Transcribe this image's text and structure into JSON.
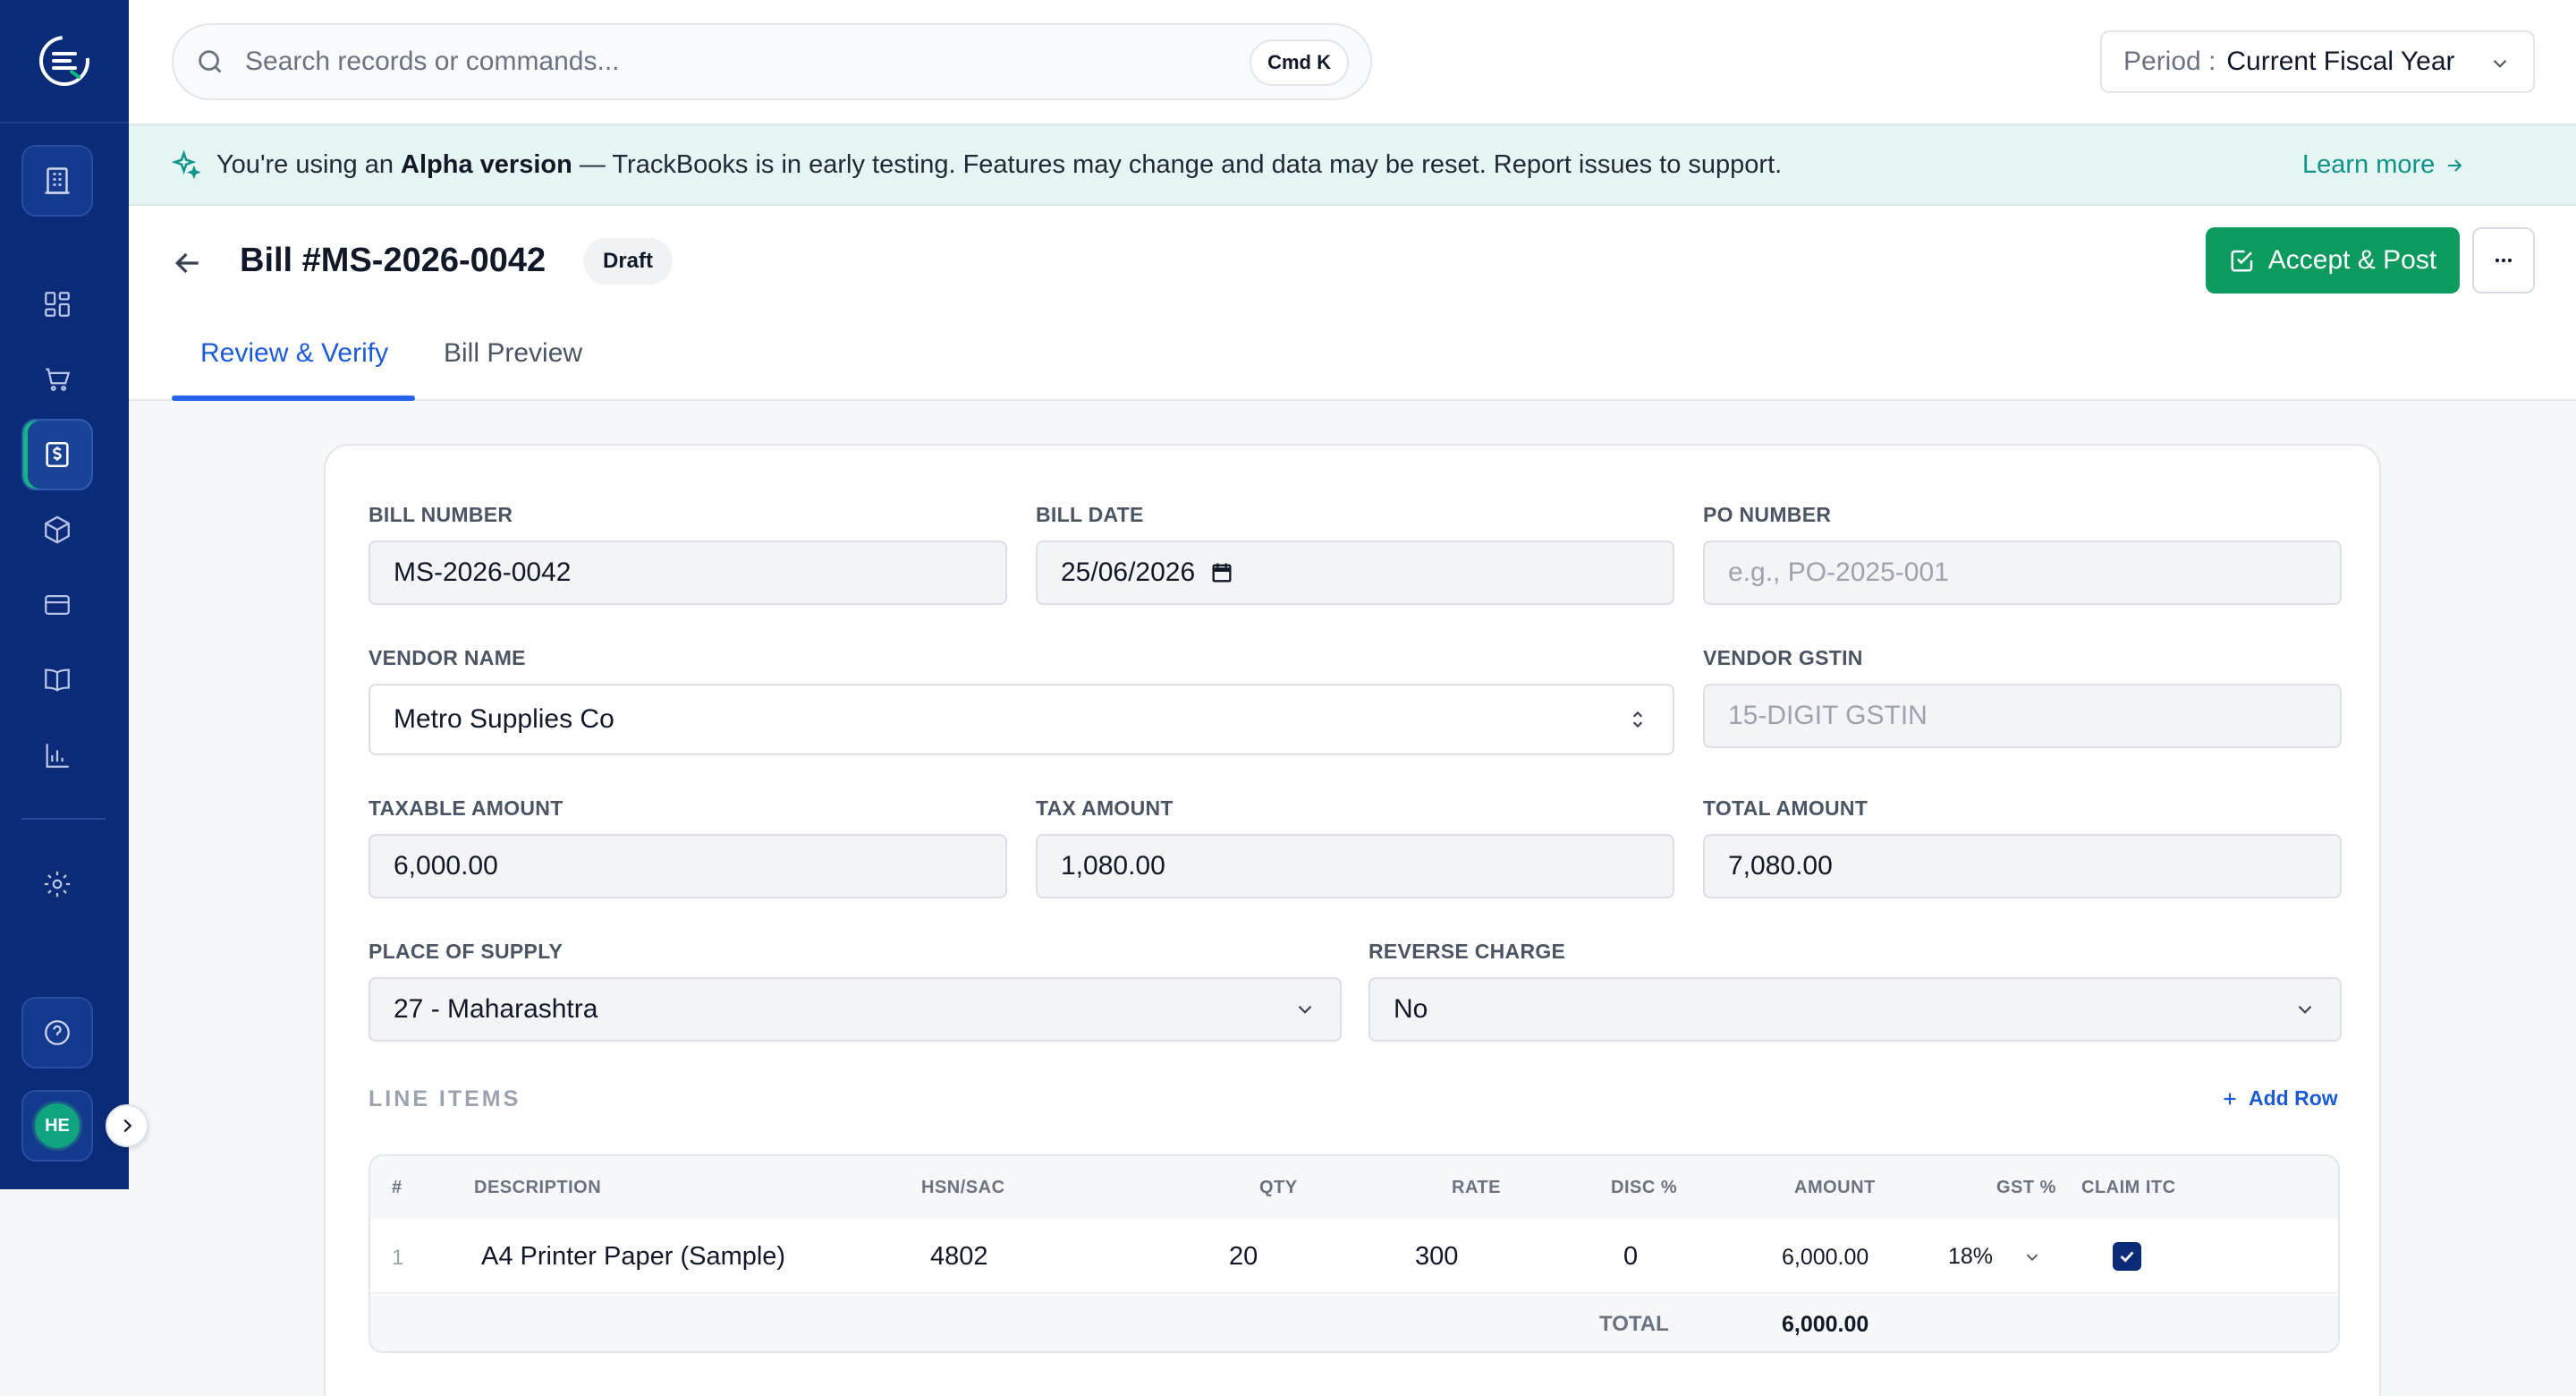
{
  "sidebar": {
    "items": [
      {
        "icon": "building-icon"
      },
      {
        "icon": "dashboard-icon"
      },
      {
        "icon": "cart-icon"
      },
      {
        "icon": "bill-icon",
        "active": true
      },
      {
        "icon": "box-icon"
      },
      {
        "icon": "card-icon"
      },
      {
        "icon": "book-icon"
      },
      {
        "icon": "chart-icon"
      },
      {
        "icon": "gear-icon"
      },
      {
        "icon": "help-icon"
      }
    ],
    "avatar_initials": "HE"
  },
  "topbar": {
    "search_placeholder": "Search records or commands...",
    "shortcut": "Cmd K",
    "period_label": "Period :",
    "period_value": "Current Fiscal Year"
  },
  "banner": {
    "prefix": "You're using an ",
    "highlight": "Alpha version",
    "suffix": " — TrackBooks is in early testing. Features may change and data may be reset. Report issues to support.",
    "link": "Learn more"
  },
  "header": {
    "title": "Bill #MS-2026-0042",
    "status": "Draft",
    "primary_action": "Accept & Post",
    "tabs": [
      "Review & Verify",
      "Bill Preview"
    ]
  },
  "form": {
    "bill_number_label": "BILL NUMBER",
    "bill_number": "MS-2026-0042",
    "bill_date_label": "BILL DATE",
    "bill_date": "25/06/2026",
    "po_number_label": "PO NUMBER",
    "po_number_placeholder": "e.g., PO-2025-001",
    "vendor_name_label": "VENDOR NAME",
    "vendor_name": "Metro Supplies Co",
    "vendor_gstin_label": "VENDOR GSTIN",
    "vendor_gstin_placeholder": "15-DIGIT GSTIN",
    "taxable_amount_label": "TAXABLE AMOUNT",
    "taxable_amount": "6,000.00",
    "tax_amount_label": "TAX AMOUNT",
    "tax_amount": "1,080.00",
    "total_amount_label": "TOTAL AMOUNT",
    "total_amount": "7,080.00",
    "place_of_supply_label": "PLACE OF SUPPLY",
    "place_of_supply": "27 - Maharashtra",
    "reverse_charge_label": "REVERSE CHARGE",
    "reverse_charge": "No"
  },
  "line_items": {
    "title": "LINE ITEMS",
    "add_row": "Add Row",
    "columns": [
      "#",
      "DESCRIPTION",
      "HSN/SAC",
      "QTY",
      "RATE",
      "DISC %",
      "AMOUNT",
      "GST %",
      "CLAIM ITC"
    ],
    "rows": [
      {
        "num": "1",
        "description": "A4 Printer Paper (Sample)",
        "hsn": "4802",
        "qty": "20",
        "rate": "300",
        "disc": "0",
        "amount": "6,000.00",
        "gst": "18%",
        "claim_itc": true
      }
    ],
    "total_label": "TOTAL",
    "total_value": "6,000.00"
  },
  "colors": {
    "sidebar": "#0b2a78",
    "accent_green": "#0c9a5f",
    "link_blue": "#1d5bd6",
    "banner_bg": "#e4f5f3",
    "banner_teal": "#0d9488"
  }
}
